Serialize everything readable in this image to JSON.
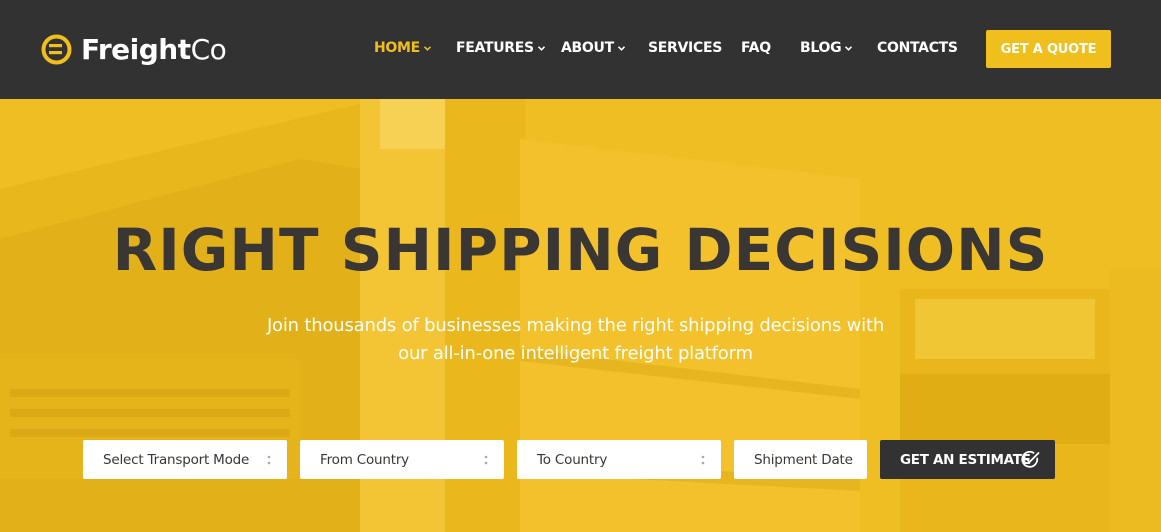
{
  "brand": {
    "name_bold": "Freight",
    "name_light": "Co",
    "logo_icon": "freightco-logo-icon",
    "color_accent": "#f0bf1e",
    "color_dark": "#323232"
  },
  "nav": {
    "items": [
      {
        "label": "HOME",
        "has_dropdown": true,
        "active": true
      },
      {
        "label": "FEATURES",
        "has_dropdown": true,
        "active": false
      },
      {
        "label": "ABOUT",
        "has_dropdown": true,
        "active": false
      },
      {
        "label": "SERVICES",
        "has_dropdown": false,
        "active": false
      },
      {
        "label": "FAQ",
        "has_dropdown": false,
        "active": false
      },
      {
        "label": "BLOG",
        "has_dropdown": true,
        "active": false
      },
      {
        "label": "CONTACTS",
        "has_dropdown": false,
        "active": false
      }
    ],
    "cta_label": "GET A QUOTE"
  },
  "hero": {
    "title": "RIGHT SHIPPING DECISIONS",
    "subtitle_line1": "Join thousands of businesses making the right shipping decisions with",
    "subtitle_line2": "our all-in-one intelligent freight platform"
  },
  "estimate_form": {
    "transport_mode": {
      "value": "Select Transport Mode",
      "icon": "select-arrows-icon"
    },
    "from_country": {
      "value": "From Country",
      "icon": "select-arrows-icon"
    },
    "to_country": {
      "value": "To Country",
      "icon": "select-arrows-icon"
    },
    "shipment_date": {
      "placeholder": "Shipment Date"
    },
    "submit_label": "GET AN ESTIMATE",
    "submit_icon": "check-circle-icon"
  }
}
